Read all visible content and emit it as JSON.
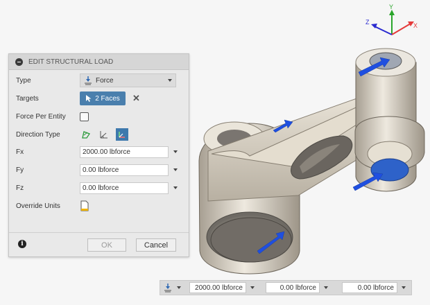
{
  "panel": {
    "title": "EDIT STRUCTURAL LOAD",
    "type": {
      "label": "Type",
      "value": "Force"
    },
    "targets": {
      "label": "Targets",
      "value": "2 Faces"
    },
    "force_per_entity": {
      "label": "Force Per Entity",
      "checked": false
    },
    "direction_type": {
      "label": "Direction Type",
      "options": [
        "vector-icon",
        "angle-icon",
        "components-icon"
      ],
      "selected": "components-icon"
    },
    "fx": {
      "label": "Fx",
      "value": "2000.00 lbforce"
    },
    "fy": {
      "label": "Fy",
      "value": "0.00 lbforce"
    },
    "fz": {
      "label": "Fz",
      "value": "0.00 lbforce"
    },
    "override_units": {
      "label": "Override Units"
    },
    "ok_label": "OK",
    "cancel_label": "Cancel"
  },
  "axes": {
    "x": "X",
    "y": "Y",
    "z": "Z"
  },
  "value_bar": {
    "fx": "2000.00 lbforce",
    "fy": "0.00 lbforce",
    "fz": "0.00 lbforce"
  },
  "colors": {
    "accent": "#3e79ad",
    "load_arrow": "#1f4fe0",
    "part": "#ddd6c8"
  }
}
